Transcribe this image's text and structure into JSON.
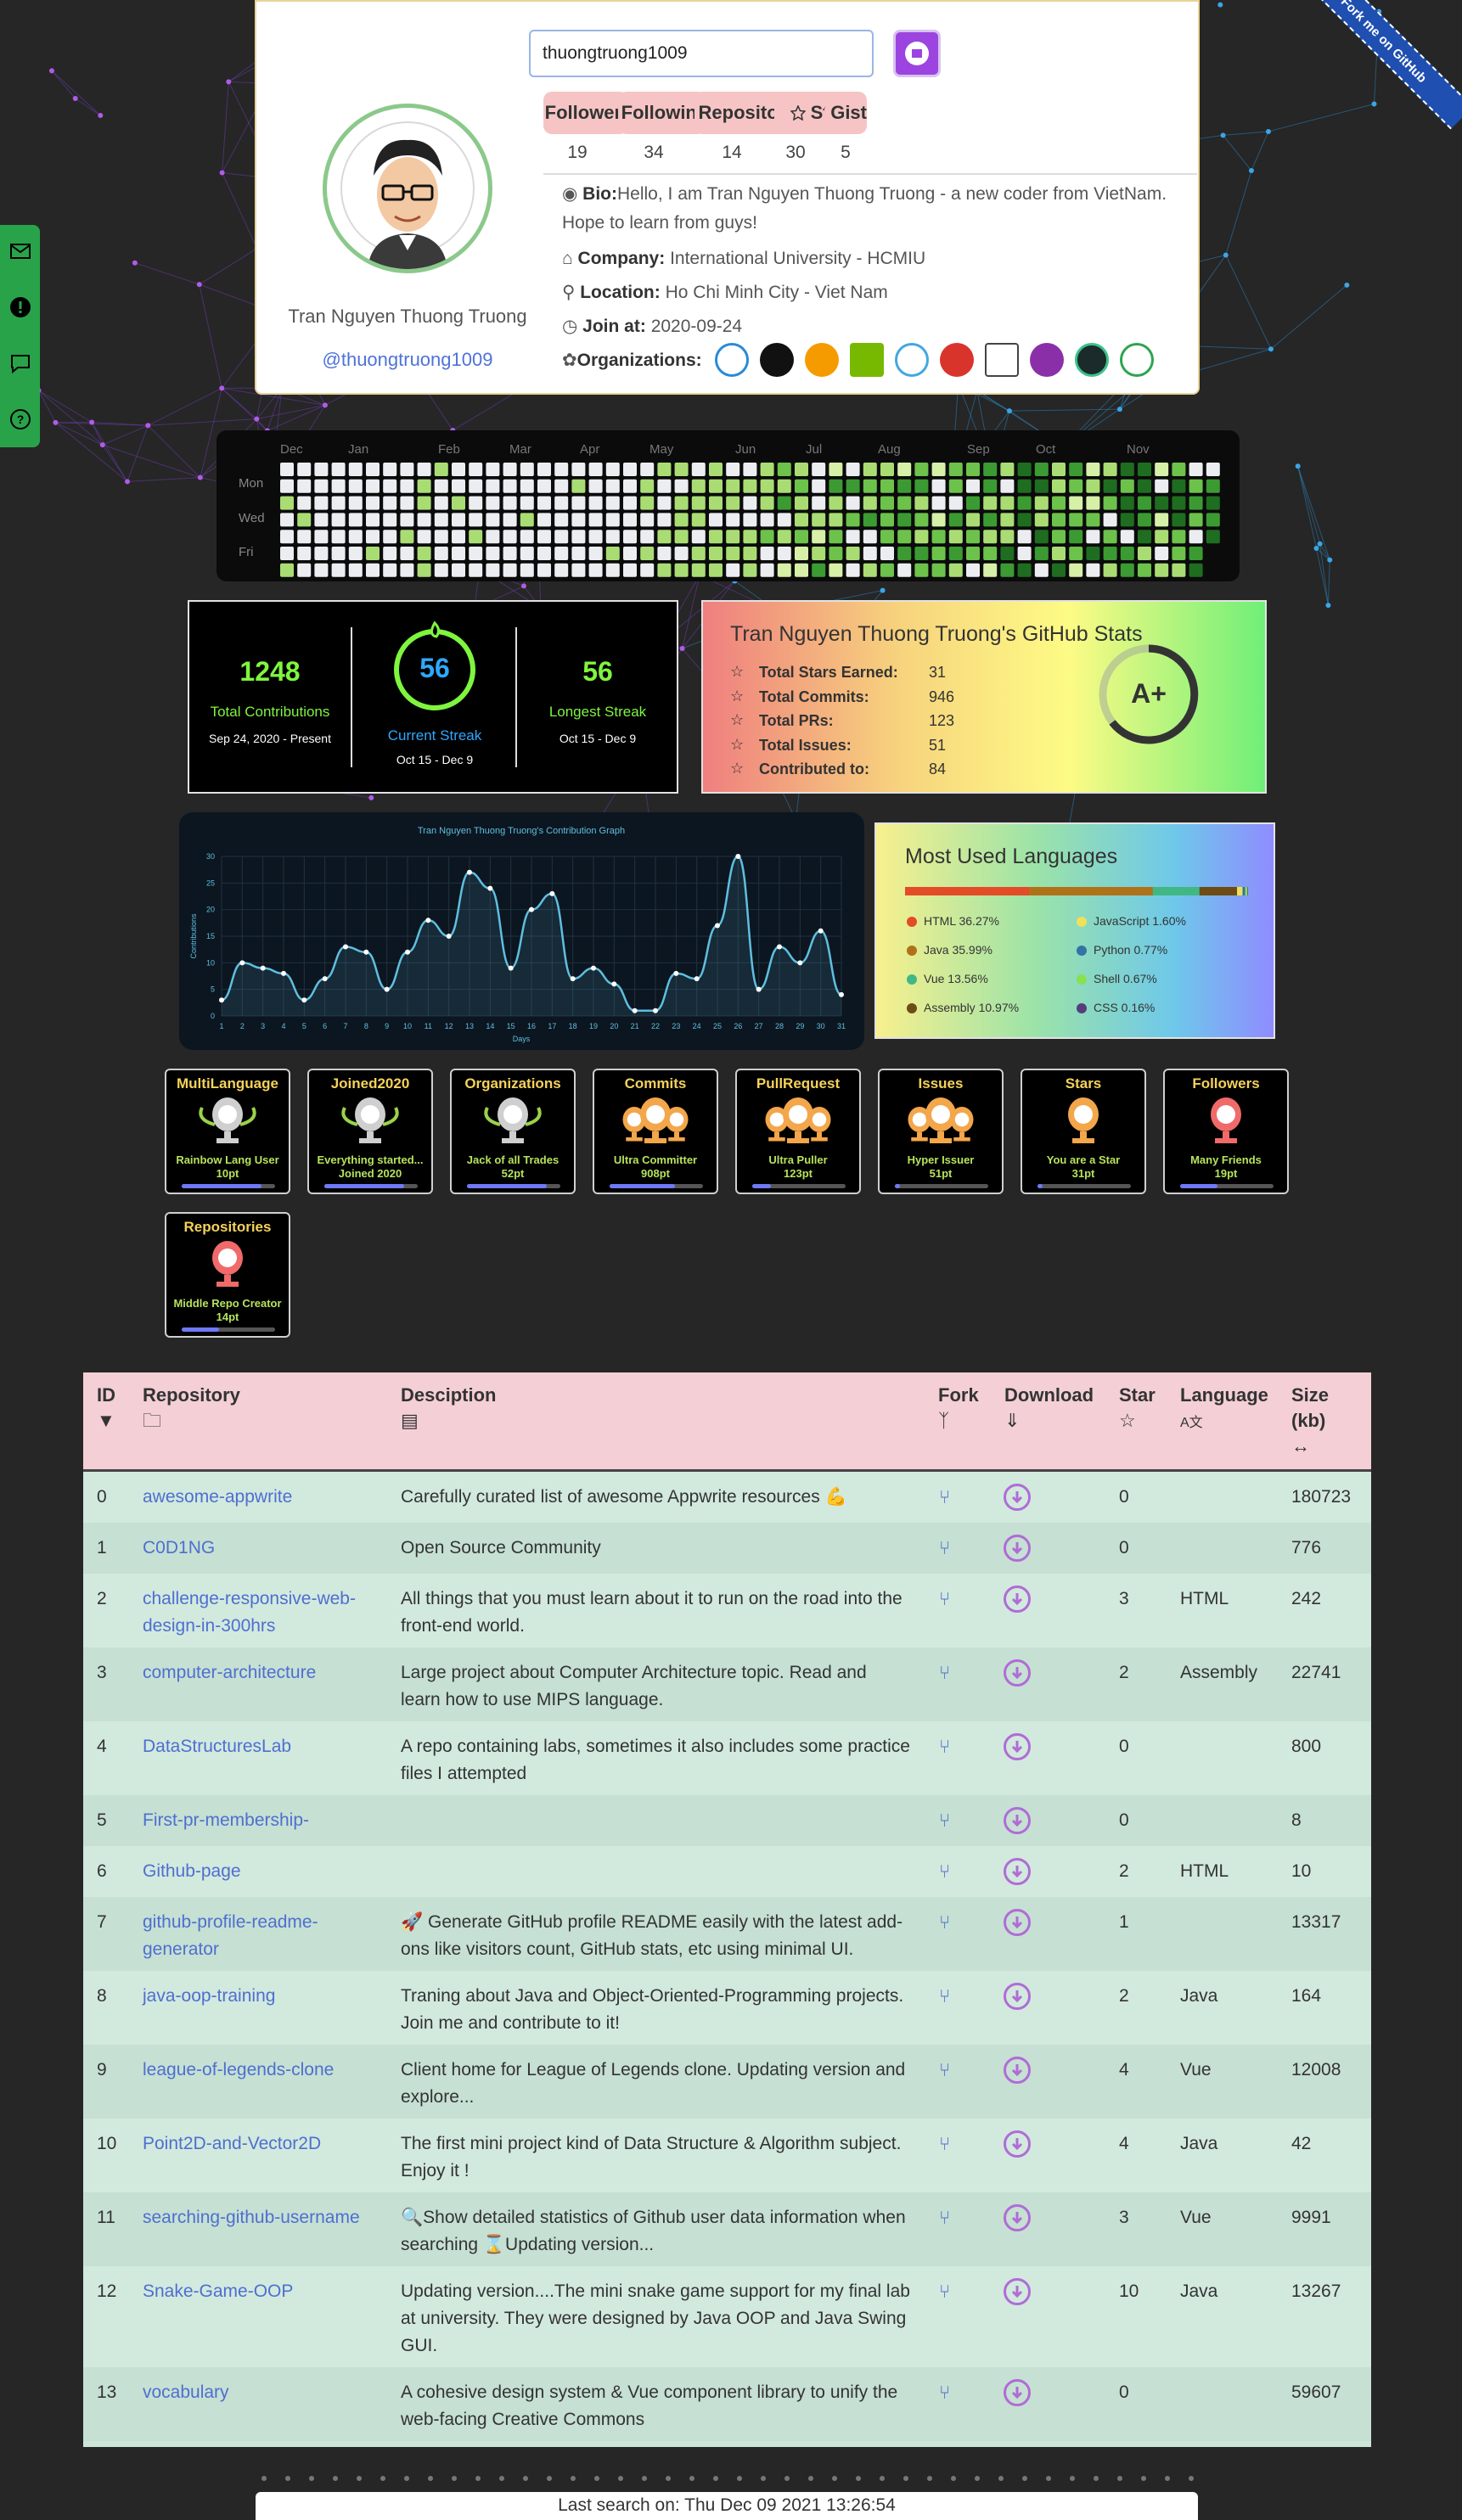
{
  "search": {
    "value": "thuongtruong1009"
  },
  "profile": {
    "name": "Tran Nguyen Thuong Truong",
    "login": "@thuongtruong1009"
  },
  "ribbon": "Fork me on GitHub",
  "stats_tabs": [
    {
      "label": "Followers",
      "count": "19"
    },
    {
      "label": "Following",
      "count": "34"
    },
    {
      "label": "Repository",
      "count": "14"
    },
    {
      "label": "Star",
      "count": "30"
    },
    {
      "label": "Gist",
      "count": "5"
    }
  ],
  "bio": {
    "label": "Bio:",
    "text": "Hello, I am Tran Nguyen Thuong Truong - a new coder from VietNam. Hope to learn from guys!"
  },
  "company": {
    "label": "Company:",
    "text": "International University - HCMIU"
  },
  "location": {
    "label": "Location:",
    "text": "Ho Chi Minh City - Viet Nam"
  },
  "join": {
    "label": "Join at:",
    "text": "2020-09-24"
  },
  "organizations": {
    "label": "Organizations:",
    "items": [
      "circles",
      "black-cat",
      "hi-logo",
      "nvidia",
      "cyan-circle",
      "jazz-band",
      "fn",
      "php",
      "ztm",
      "vue-green"
    ]
  },
  "heatmap": {
    "months": [
      "Dec",
      "Jan",
      "Feb",
      "Mar",
      "Apr",
      "May",
      "Jun",
      "Jul",
      "Aug",
      "Sep",
      "Oct",
      "Nov"
    ],
    "days": [
      "Mon",
      "Wed",
      "Fri"
    ]
  },
  "streak": {
    "total": "1248",
    "total_label": "Total Contributions",
    "total_range": "Sep 24, 2020 - Present",
    "current": "56",
    "current_label": "Current Streak",
    "current_range": "Oct 15 - Dec 9",
    "longest": "56",
    "longest_label": "Longest Streak",
    "longest_range": "Oct 15 - Dec 9"
  },
  "github_stats": {
    "title": "Tran Nguyen Thuong Truong's GitHub Stats",
    "rows": [
      {
        "label": "Total Stars Earned:",
        "value": "31"
      },
      {
        "label": "Total Commits:",
        "value": "946"
      },
      {
        "label": "Total PRs:",
        "value": "123"
      },
      {
        "label": "Total Issues:",
        "value": "51"
      },
      {
        "label": "Contributed to:",
        "value": "84"
      }
    ],
    "grade": "A+"
  },
  "chart_data": {
    "type": "line",
    "title": "Tran Nguyen Thuong Truong's Contribution Graph",
    "xlabel": "Days",
    "ylabel": "Contributions",
    "x": [
      1,
      2,
      3,
      4,
      5,
      6,
      7,
      8,
      9,
      10,
      11,
      12,
      13,
      14,
      15,
      16,
      17,
      18,
      19,
      20,
      21,
      22,
      23,
      24,
      25,
      26,
      27,
      28,
      29,
      30,
      31
    ],
    "series": [
      {
        "values": [
          3,
          10,
          9,
          8,
          3,
          7,
          13,
          12,
          5,
          12,
          18,
          15,
          27,
          24,
          9,
          20,
          23,
          7,
          9,
          6,
          1,
          1,
          8,
          7,
          17,
          30,
          5,
          13,
          10,
          16,
          4
        ]
      }
    ],
    "ylim": [
      0,
      30
    ],
    "yticks": [
      0,
      5,
      10,
      15,
      20,
      25,
      30
    ],
    "grid": true
  },
  "languages": {
    "title": "Most Used Languages",
    "items": [
      {
        "name": "HTML 36.27%",
        "pct": 36.27,
        "color": "#e34c26"
      },
      {
        "name": "Java 35.99%",
        "pct": 35.99,
        "color": "#b07219"
      },
      {
        "name": "Vue 13.56%",
        "pct": 13.56,
        "color": "#41b883"
      },
      {
        "name": "Assembly 10.97%",
        "pct": 10.97,
        "color": "#6e4c13"
      },
      {
        "name": "JavaScript 1.60%",
        "pct": 1.6,
        "color": "#f1e05a"
      },
      {
        "name": "Python 0.77%",
        "pct": 0.77,
        "color": "#3572a5"
      },
      {
        "name": "Shell 0.67%",
        "pct": 0.67,
        "color": "#89e051"
      },
      {
        "name": "CSS 0.16%",
        "pct": 0.16,
        "color": "#563d7c"
      }
    ]
  },
  "trophies": [
    {
      "title": "MultiLanguage",
      "rank": "S",
      "desc1": "Rainbow Lang User",
      "desc2": "10pt",
      "progress": 0.85
    },
    {
      "title": "Joined2020",
      "rank": "S",
      "desc1": "Everything started...",
      "desc2": "Joined 2020",
      "progress": 0.85
    },
    {
      "title": "Organizations",
      "rank": "S",
      "desc1": "Jack of all Trades",
      "desc2": "52pt",
      "progress": 0.85
    },
    {
      "title": "Commits",
      "rank": "AAA",
      "desc1": "Ultra Committer",
      "desc2": "908pt",
      "progress": 0.7
    },
    {
      "title": "PullRequest",
      "rank": "AAA",
      "desc1": "Ultra Puller",
      "desc2": "123pt",
      "progress": 0.2
    },
    {
      "title": "Issues",
      "rank": "AAA",
      "desc1": "Hyper Issuer",
      "desc2": "51pt",
      "progress": 0.05
    },
    {
      "title": "Stars",
      "rank": "A",
      "desc1": "You are a Star",
      "desc2": "31pt",
      "progress": 0.05
    },
    {
      "title": "Followers",
      "rank": "B",
      "desc1": "Many Friends",
      "desc2": "19pt",
      "progress": 0.4
    },
    {
      "title": "Repositories",
      "rank": "B",
      "desc1": "Middle Repo Creator",
      "desc2": "14pt",
      "progress": 0.4
    }
  ],
  "table": {
    "headers": {
      "id": "ID",
      "repo": "Repository",
      "desc": "Desciption",
      "fork": "Fork",
      "download": "Download",
      "star": "Star",
      "language": "Language",
      "size": "Size (kb)"
    },
    "rows": [
      {
        "id": "0",
        "name": "awesome-appwrite",
        "desc": "Carefully curated list of awesome Appwrite resources 💪",
        "star": "0",
        "lang": "",
        "size": "180723"
      },
      {
        "id": "1",
        "name": "C0D1NG",
        "desc": "Open Source Community",
        "star": "0",
        "lang": "",
        "size": "776"
      },
      {
        "id": "2",
        "name": "challenge-responsive-web-design-in-300hrs",
        "desc": "All things that you must learn about it to run on the road into the front-end world.",
        "star": "3",
        "lang": "HTML",
        "size": "242"
      },
      {
        "id": "3",
        "name": "computer-architecture",
        "desc": "Large project about Computer Architecture topic. Read and learn how to use MIPS language.",
        "star": "2",
        "lang": "Assembly",
        "size": "22741"
      },
      {
        "id": "4",
        "name": "DataStructuresLab",
        "desc": "A repo containing labs, sometimes it also includes some practice files I attempted",
        "star": "0",
        "lang": "",
        "size": "800"
      },
      {
        "id": "5",
        "name": "First-pr-membership-",
        "desc": "",
        "star": "0",
        "lang": "",
        "size": "8"
      },
      {
        "id": "6",
        "name": "Github-page",
        "desc": "",
        "star": "2",
        "lang": "HTML",
        "size": "10"
      },
      {
        "id": "7",
        "name": "github-profile-readme-generator",
        "desc": "🚀 Generate GitHub profile README easily with the latest add-ons like visitors count, GitHub stats, etc using minimal UI.",
        "star": "1",
        "lang": "",
        "size": "13317"
      },
      {
        "id": "8",
        "name": "java-oop-training",
        "desc": "Traning about Java and Object-Oriented-Programming projects. Join me and contribute to it!",
        "star": "2",
        "lang": "Java",
        "size": "164"
      },
      {
        "id": "9",
        "name": "league-of-legends-clone",
        "desc": "Client home for League of Legends clone. Updating version and explore...",
        "star": "4",
        "lang": "Vue",
        "size": "12008"
      },
      {
        "id": "10",
        "name": "Point2D-and-Vector2D",
        "desc": "The first mini project kind of Data Structure & Algorithm subject. Enjoy it !",
        "star": "4",
        "lang": "Java",
        "size": "42"
      },
      {
        "id": "11",
        "name": "searching-github-username",
        "desc": "🔍Show detailed statistics of Github user data information when searching ⌛Updating version...",
        "star": "3",
        "lang": "Vue",
        "size": "9991"
      },
      {
        "id": "12",
        "name": "Snake-Game-OOP",
        "desc": "Updating version....The mini snake game support for my final lab at university. They were designed by Java OOP and Java Swing GUI.",
        "star": "10",
        "lang": "Java",
        "size": "13267"
      },
      {
        "id": "13",
        "name": "vocabulary",
        "desc": "A cohesive design system & Vue component library to unify the web-facing Creative Commons",
        "star": "0",
        "lang": "",
        "size": "59607"
      }
    ]
  },
  "footer": {
    "text": "Last search on: Thu Dec 09 2021 13:26:54"
  }
}
